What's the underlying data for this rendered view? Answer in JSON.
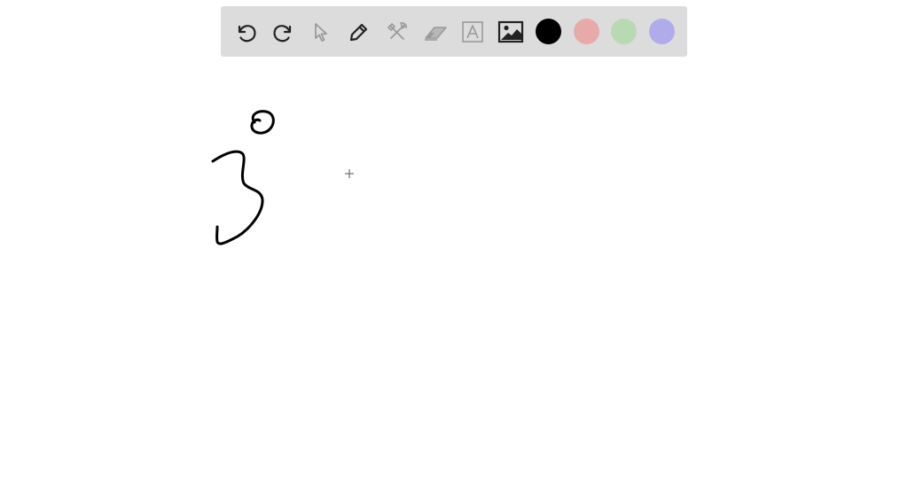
{
  "toolbar": {
    "tools": [
      {
        "id": "undo",
        "icon": "undo-icon",
        "enabled": true
      },
      {
        "id": "redo",
        "icon": "redo-icon",
        "enabled": true
      },
      {
        "id": "select",
        "icon": "pointer-icon",
        "enabled": false
      },
      {
        "id": "pen",
        "icon": "pencil-icon",
        "enabled": true,
        "selected": true
      },
      {
        "id": "tools",
        "icon": "hammer-wrench-icon",
        "enabled": false
      },
      {
        "id": "eraser",
        "icon": "eraser-icon",
        "enabled": false
      },
      {
        "id": "text",
        "icon": "text-box-icon",
        "enabled": false
      },
      {
        "id": "image",
        "icon": "image-icon",
        "enabled": true
      }
    ],
    "colors": [
      {
        "name": "black",
        "hex": "#000000",
        "selected": true
      },
      {
        "name": "red",
        "hex": "#e8a9a9"
      },
      {
        "name": "green",
        "hex": "#b9d9b3"
      },
      {
        "name": "purple",
        "hex": "#b0acec"
      }
    ]
  },
  "canvas": {
    "stroke_color": "#000000",
    "cursor": "crosshair"
  }
}
